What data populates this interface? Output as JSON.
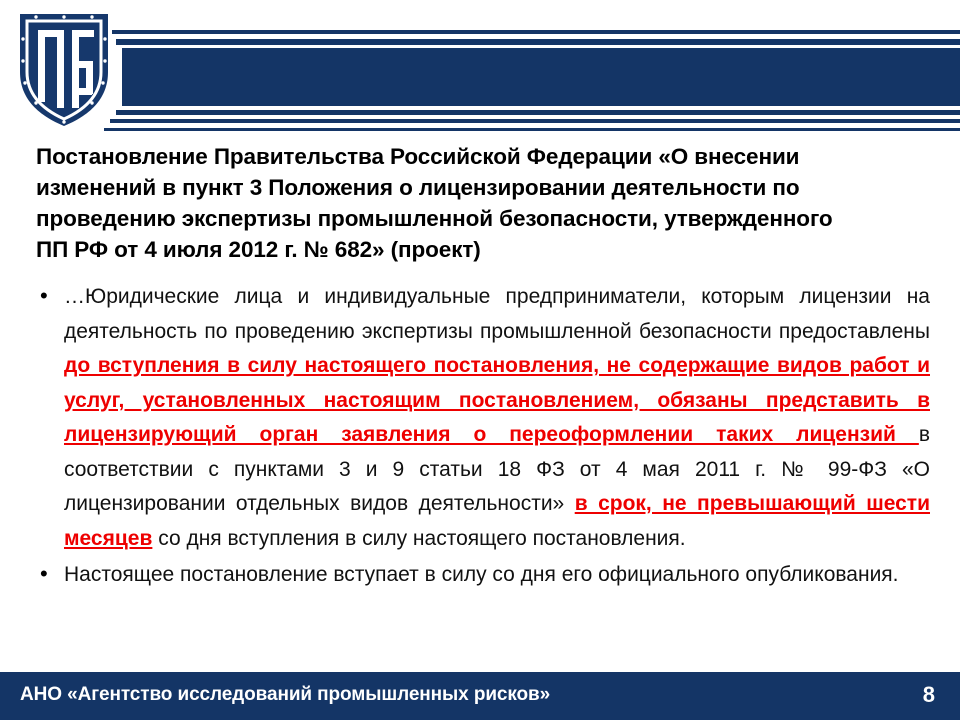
{
  "theme": {
    "navy": "#143566",
    "red": "#ee0000",
    "white": "#ffffff",
    "black": "#000000"
  },
  "header": {
    "logo_icon": "shield-logo-icon",
    "logo_monogram": "ПБ"
  },
  "title": {
    "line1": "Постановление Правительства Российской Федерации «О внесении",
    "line2": "изменений в пункт 3 Положения о лицензировании деятельности по",
    "line3": "проведению экспертизы промышленной безопасности, утвержденного",
    "line4": "ПП РФ от 4 июля 2012 г. № 682» (проект)"
  },
  "body": {
    "bullet1": {
      "part1": "…Юридические лица и индивидуальные предприниматели, которым лицензии на деятельность по проведению экспертизы промышленной безопасности предоставлены ",
      "highlight1": "до вступления в силу настоящего постановления, не содержащие видов работ и услуг, установленных настоящим постановлением, обязаны  представить в лицензирующий орган заявления о переоформлении таких лицензий ",
      "part2": " в соответствии с пунктами 3 и 9 статьи 18 ФЗ от 4 мая 2011 г. № 99-ФЗ «О лицензировании отдельных видов деятельности» ",
      "highlight2": "в срок, не превышающий шести месяцев",
      "part3": " со дня вступления в силу настоящего постановления."
    },
    "bullet2": {
      "text": "Настоящее постановление вступает в силу со дня его официального опубликования."
    }
  },
  "footer": {
    "organization": "АНО «Агентство исследований промышленных рисков»",
    "page_number": "8"
  }
}
